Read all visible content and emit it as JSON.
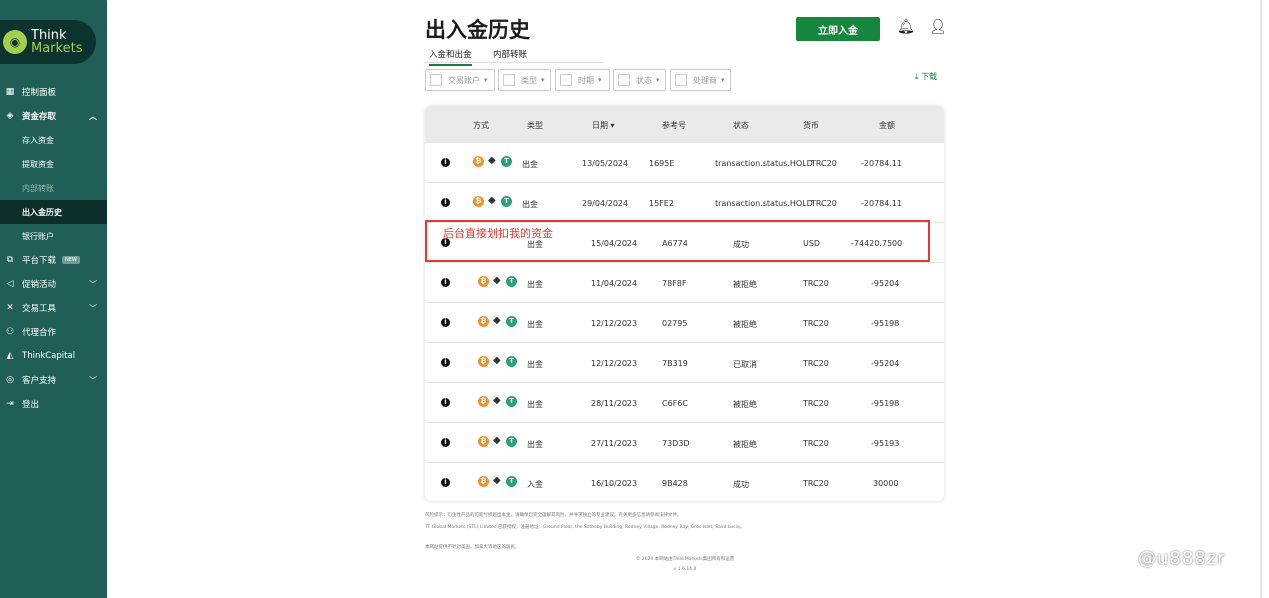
{
  "sidebar": {
    "logo": {
      "line1": "Think",
      "line2": "Markets"
    },
    "items": [
      {
        "icon": "dashboard-icon",
        "label": "控制面板"
      },
      {
        "icon": "wallet-icon",
        "label": "资金存取"
      },
      {
        "label": "存入资金"
      },
      {
        "label": "提取资金"
      },
      {
        "label": "内部转账"
      },
      {
        "label": "出入金历史"
      },
      {
        "label": "银行账户"
      },
      {
        "icon": "download-icon",
        "label": "平台下载",
        "badge": "NEW"
      },
      {
        "icon": "megaphone-icon",
        "label": "促销活动"
      },
      {
        "icon": "tools-icon",
        "label": "交易工具"
      },
      {
        "icon": "partners-icon",
        "label": "代理合作"
      },
      {
        "icon": "chart-icon",
        "label": "ThinkCapital"
      },
      {
        "icon": "support-icon",
        "label": "客户支持"
      },
      {
        "icon": "logout-icon",
        "label": "登出"
      }
    ]
  },
  "header": {
    "title": "出入金历史",
    "tabs": [
      "入金和出金",
      "内部转账"
    ],
    "cta": "立即入金"
  },
  "filters": [
    "交易账户",
    "类型",
    "时期",
    "状态",
    "处理商"
  ],
  "download_label": "下载",
  "table": {
    "columns": [
      "方式",
      "类型",
      "日期",
      "参考号",
      "状态",
      "货币",
      "金额"
    ],
    "rows": [
      {
        "type": "出金",
        "date": "13/05/2024",
        "ref": "1695E",
        "status": "transaction.status.HOLD",
        "currency": "TRC20",
        "amount": "-20784.11"
      },
      {
        "type": "出金",
        "date": "29/04/2024",
        "ref": "15FE2",
        "status": "transaction.status.HOLD",
        "currency": "TRC20",
        "amount": "-20784.11"
      },
      {
        "type": "出金",
        "date": "15/04/2024",
        "ref": "A6774",
        "status": "成功",
        "currency": "USD",
        "amount": "-74420.7500"
      },
      {
        "type": "出金",
        "date": "11/04/2024",
        "ref": "78F8F",
        "status": "被拒绝",
        "currency": "TRC20",
        "amount": "-95204"
      },
      {
        "type": "出金",
        "date": "12/12/2023",
        "ref": "02795",
        "status": "被拒绝",
        "currency": "TRC20",
        "amount": "-95198"
      },
      {
        "type": "出金",
        "date": "12/12/2023",
        "ref": "7B319",
        "status": "已取消",
        "currency": "TRC20",
        "amount": "-95204"
      },
      {
        "type": "出金",
        "date": "28/11/2023",
        "ref": "C6F6C",
        "status": "被拒绝",
        "currency": "TRC20",
        "amount": "-95198"
      },
      {
        "type": "出金",
        "date": "27/11/2023",
        "ref": "73D3D",
        "status": "被拒绝",
        "currency": "TRC20",
        "amount": "-95193"
      },
      {
        "type": "入金",
        "date": "16/10/2023",
        "ref": "9B428",
        "status": "成功",
        "currency": "TRC20",
        "amount": "30000"
      }
    ]
  },
  "annotation": "后台直接划扣我的资金",
  "footer": {
    "risk": "风险提示：衍生性产品的可能亏损超出本金。请确保您完全理解其风险，并寻求独立的专业建议。有关更多信息请参阅法律文件。",
    "entity": "TF Global Markets (STL) Limited 已获授权。注册地址：Ground Floor, the Sotheby Building, Rodney Village, Rodney Bay, Gros-Islet, Saint Lucia。",
    "note": "本网站提供不针对美国、加拿大等地区的居民。",
    "copyright": "© 2024 本网站由ThinkMarkets集团所有和运营",
    "version": "v 1.6.14.0"
  },
  "watermark": "@u888zr"
}
